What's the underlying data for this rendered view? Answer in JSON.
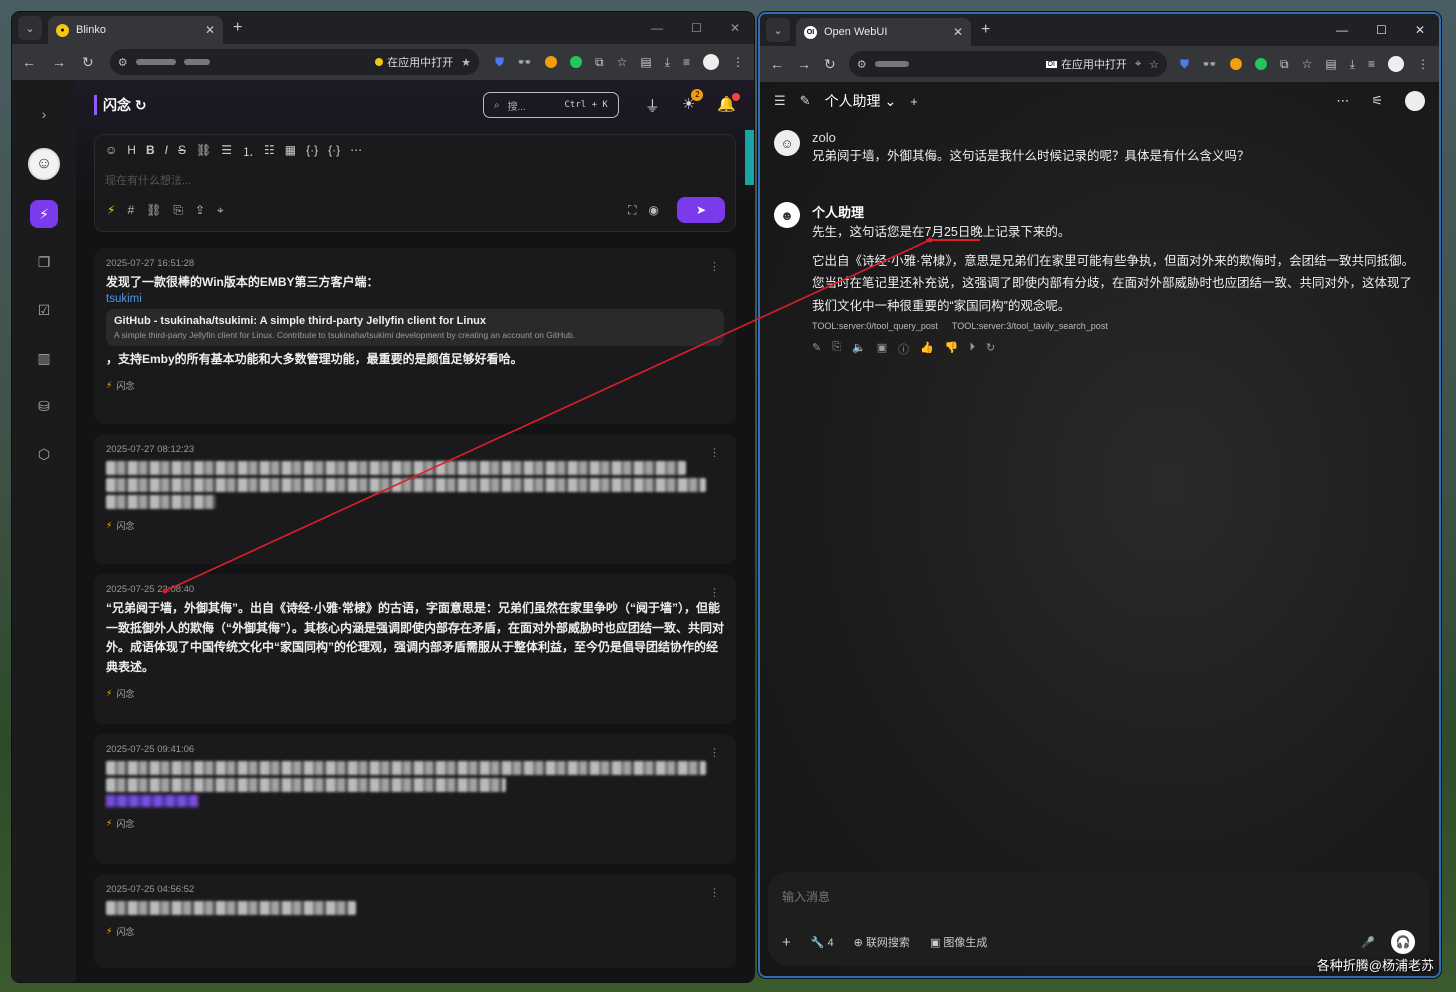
{
  "blinko_window": {
    "tab_title": "Blinko",
    "open_in_app": "在应用中打开",
    "header": {
      "title": "闪念",
      "search_placeholder": "搜...",
      "search_shortcut": "Ctrl + K",
      "badge_count": "2"
    },
    "editor": {
      "placeholder": "现在有什么想法..."
    },
    "notes": [
      {
        "time": "2025-07-27 16:51:28",
        "text": "发现了一款很棒的Win版本的EMBY第三方客户端：",
        "link": "tsukimi",
        "card_title": "GitHub - tsukinaha/tsukimi: A simple third-party Jellyfin client for Linux",
        "card_desc": "A simple third-party Jellyfin client for Linux. Contribute to tsukinaha/tsukimi development by creating an account on GitHub.",
        "text2": "，支持Emby的所有基本功能和大多数管理功能，最重要的是颜值足够好看哈。",
        "tag": "闪念"
      },
      {
        "time": "2025-07-27 08:12:23",
        "tag": "闪念"
      },
      {
        "time": "2025-07-25 22:08:40",
        "text": "“兄弟阋于墙，外御其侮”。出自《诗经·小雅·常棣》的古语，字面意思是：兄弟们虽然在家里争吵（“阋于墙”），但能一致抵御外人的欺侮（“外御其侮”）。其核心内涵是强调即使内部存在矛盾，在面对外部威胁时也应团结一致、共同对外。成语体现了中国传统文化中“家国同构”的伦理观，强调内部矛盾需服从于整体利益，至今仍是倡导团结协作的经典表述。",
        "tag": "闪念"
      },
      {
        "time": "2025-07-25 09:41:06",
        "tag": "闪念"
      },
      {
        "time": "2025-07-25 04:56:52",
        "tag": "闪念"
      }
    ]
  },
  "webui_window": {
    "tab_title": "Open WebUI",
    "open_in_app": "在应用中打开",
    "model_name": "个人助理",
    "messages": [
      {
        "name": "zolo",
        "text": "兄弟阋于墙，外御其侮。这句话是我什么时候记录的呢？具体是有什么含义吗？"
      },
      {
        "name": "个人助理",
        "text": "先生，这句话您是在7月25日晚上记录下来的。",
        "text2": "它出自《诗经·小雅·常棣》，意思是兄弟们在家里可能有些争执，但面对外来的欺侮时，会团结一致共同抵御。您当时在笔记里还补充说，这强调了即使内部有分歧，在面对外部威胁时也应团结一致、共同对外，这体现了我们文化中一种很重要的“家国同构”的观念呢。",
        "tools": [
          "TOOL:server:0/tool_query_post",
          "TOOL:server:3/tool_tavily_search_post"
        ]
      }
    ],
    "input": {
      "placeholder": "输入消息",
      "tools_count": "4",
      "web_search": "联网搜索",
      "image_gen": "图像生成"
    }
  },
  "watermark": "各种折腾@杨浦老苏",
  "colors": {
    "accent": "#7c3aed",
    "annotation": "#e11d2a",
    "link": "#4a9ae8"
  }
}
